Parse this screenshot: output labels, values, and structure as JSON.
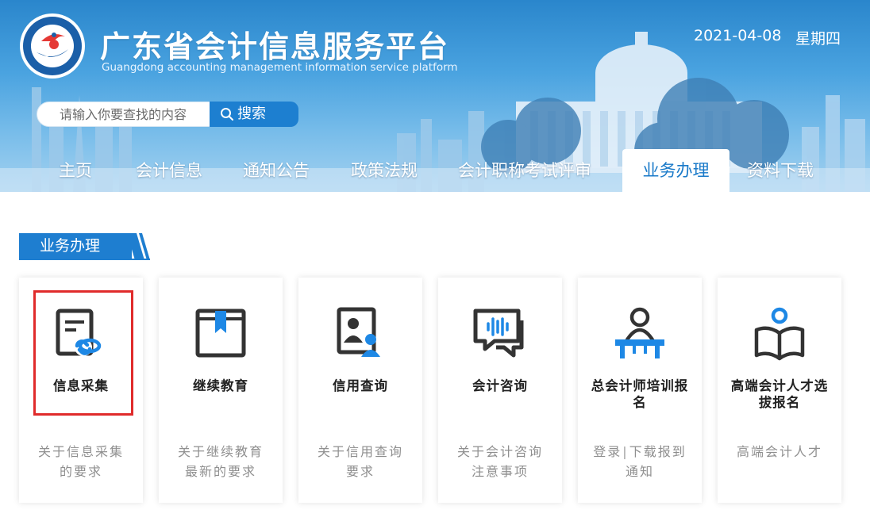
{
  "header": {
    "title_zh": "广东省会计信息服务平台",
    "title_en": "Guangdong accounting management information service platform",
    "date": "2021-04-08",
    "weekday": "星期四"
  },
  "search": {
    "placeholder": "请输入你要查找的内容",
    "button_label": "搜索",
    "button_icon": "search-icon"
  },
  "nav": {
    "items": [
      {
        "label": "主页"
      },
      {
        "label": "会计信息"
      },
      {
        "label": "通知公告"
      },
      {
        "label": "政策法规"
      },
      {
        "label": "会计职称考试评审"
      },
      {
        "label": "业务办理",
        "active": true
      },
      {
        "label": "资料下载"
      }
    ]
  },
  "section": {
    "title": "业务办理"
  },
  "cards": [
    {
      "title": "信息采集",
      "desc": "关于信息采集的要求",
      "icon": "info-collection-icon",
      "highlighted": true
    },
    {
      "title": "继续教育",
      "desc": "关于继续教育最新的要求",
      "icon": "book-bookmark-icon"
    },
    {
      "title": "信用查询",
      "desc": "关于信用查询要求",
      "icon": "user-profile-icon"
    },
    {
      "title": "会计咨询",
      "desc": "关于会计咨询注意事项",
      "icon": "chat-voice-icon"
    },
    {
      "title": "总会计师培训报名",
      "desc_part1": "登录",
      "desc_sep": "|",
      "desc_part2": "下载报到通知",
      "icon": "presenter-icon"
    },
    {
      "title": "高端会计人才选拔报名",
      "desc": "高端会计人才",
      "icon": "reader-icon"
    }
  ],
  "colors": {
    "primary": "#1e7ed0",
    "header_top": "#2a86cc",
    "highlight": "#e02b2b",
    "icon_dark": "#333333",
    "icon_accent": "#1e88e5"
  }
}
